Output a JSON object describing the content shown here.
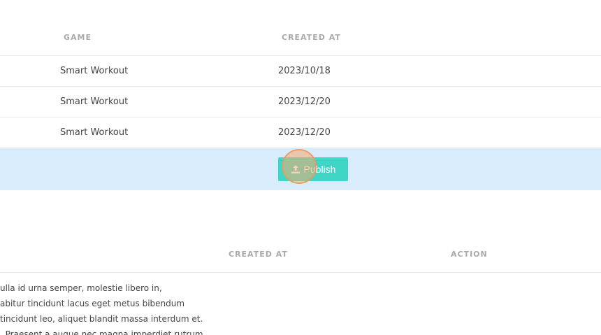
{
  "table1": {
    "headers": {
      "game": "GAME",
      "created_at": "CREATED AT"
    },
    "rows": [
      {
        "game": "Smart Workout",
        "created_at": "2023/10/18"
      },
      {
        "game": "Smart Workout",
        "created_at": "2023/12/20"
      },
      {
        "game": "Smart Workout",
        "created_at": "2023/12/20"
      }
    ],
    "publish_label": "Publish",
    "publish_icon": "upload-icon"
  },
  "table2": {
    "headers": {
      "created_at": "CREATED AT",
      "action": "ACTION"
    },
    "description_lines": [
      "ulla id urna semper, molestie libero in,",
      "abitur tincidunt lacus eget metus bibendum",
      "tincidunt leo, aliquet blandit massa interdum et.",
      ". Praesent a augue nec magna imperdiet rutrum."
    ]
  },
  "colors": {
    "accent": "#3fd6c6",
    "highlight_row": "#d9ecfb",
    "header_text": "#aaaaaa"
  }
}
